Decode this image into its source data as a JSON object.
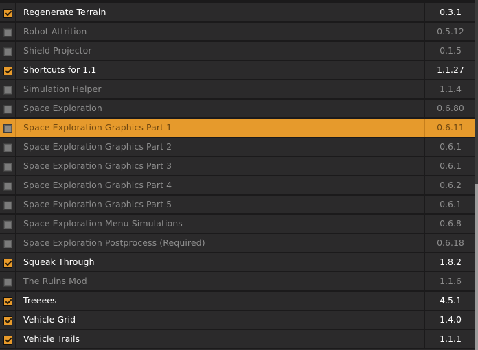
{
  "mods": [
    {
      "name": "Regenerate Terrain",
      "version": "0.3.1",
      "enabled": true,
      "selected": false
    },
    {
      "name": "Robot Attrition",
      "version": "0.5.12",
      "enabled": false,
      "selected": false
    },
    {
      "name": "Shield Projector",
      "version": "0.1.5",
      "enabled": false,
      "selected": false
    },
    {
      "name": "Shortcuts for 1.1",
      "version": "1.1.27",
      "enabled": true,
      "selected": false
    },
    {
      "name": "Simulation Helper",
      "version": "1.1.4",
      "enabled": false,
      "selected": false
    },
    {
      "name": "Space Exploration",
      "version": "0.6.80",
      "enabled": false,
      "selected": false
    },
    {
      "name": "Space Exploration Graphics Part 1",
      "version": "0.6.11",
      "enabled": false,
      "selected": true
    },
    {
      "name": "Space Exploration Graphics Part 2",
      "version": "0.6.1",
      "enabled": false,
      "selected": false
    },
    {
      "name": "Space Exploration Graphics Part 3",
      "version": "0.6.1",
      "enabled": false,
      "selected": false
    },
    {
      "name": "Space Exploration Graphics Part 4",
      "version": "0.6.2",
      "enabled": false,
      "selected": false
    },
    {
      "name": "Space Exploration Graphics Part 5",
      "version": "0.6.1",
      "enabled": false,
      "selected": false
    },
    {
      "name": "Space Exploration Menu Simulations",
      "version": "0.6.8",
      "enabled": false,
      "selected": false
    },
    {
      "name": "Space Exploration Postprocess (Required)",
      "version": "0.6.18",
      "enabled": false,
      "selected": false
    },
    {
      "name": "Squeak Through",
      "version": "1.8.2",
      "enabled": true,
      "selected": false
    },
    {
      "name": "The Ruins Mod",
      "version": "1.1.6",
      "enabled": false,
      "selected": false
    },
    {
      "name": "Treeees",
      "version": "4.5.1",
      "enabled": true,
      "selected": false
    },
    {
      "name": "Vehicle Grid",
      "version": "1.4.0",
      "enabled": true,
      "selected": false
    },
    {
      "name": "Vehicle Trails",
      "version": "1.1.1",
      "enabled": true,
      "selected": false
    }
  ],
  "colors": {
    "accent": "#e69a2c",
    "enabled_text": "#ffffff",
    "disabled_text": "#8d8d8d",
    "row_background": "#2b2a2b"
  },
  "icons": {
    "checked": "checkbox-checked-icon",
    "unchecked": "checkbox-unchecked-icon"
  }
}
